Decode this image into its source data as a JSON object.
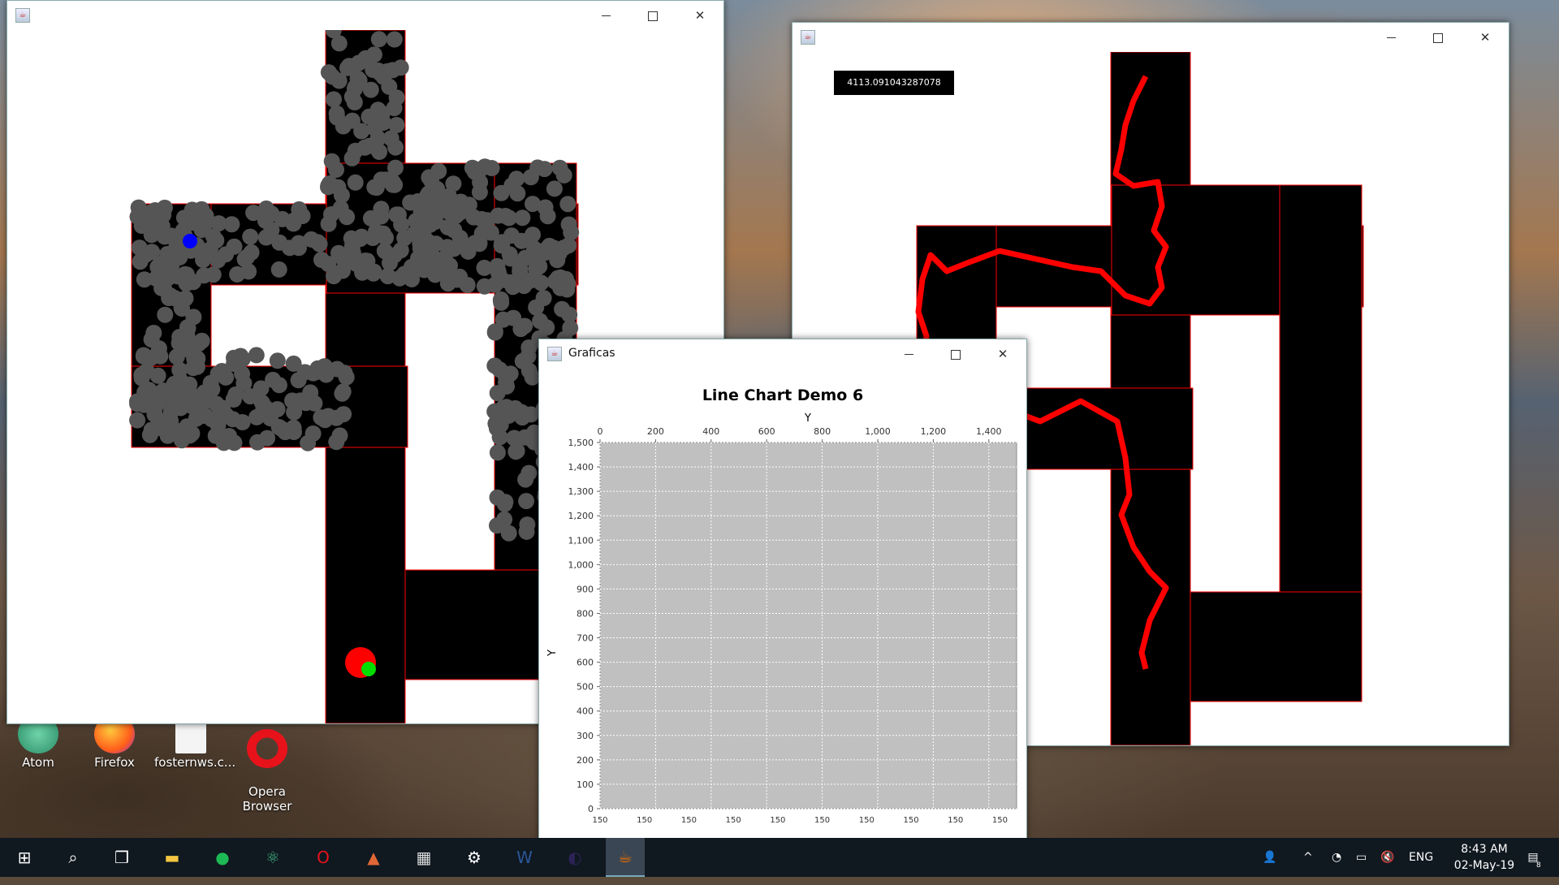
{
  "desktop_icons": [
    {
      "label": "Atom",
      "icon": "atom-icon",
      "color": "#41b883"
    },
    {
      "label": "Firefox",
      "icon": "firefox-icon",
      "color": "#ff7139"
    },
    {
      "label": "fosternws.c...",
      "icon": "file-icon",
      "color": "#f4f4f4"
    },
    {
      "label": "Opera\nBrowser",
      "icon": "opera-icon",
      "color": "#e8121b"
    }
  ],
  "window_map": {
    "title": "",
    "maze_color": "#000000",
    "visited_color": "#555555",
    "start_marker_color": "#0000ff",
    "goal_marker_color": "#ff0000",
    "agent_color": "#00dd00"
  },
  "window_path": {
    "title": "",
    "score_label": "4113.091043287078",
    "path_color": "#ff0000"
  },
  "window_chart": {
    "title": "Graficas",
    "chart_title": "Line Chart Demo 6",
    "top_axis_label": "Y",
    "left_axis_label": "Y",
    "plot_background": "#c0c0c0"
  },
  "chart_data": {
    "type": "line",
    "title": "Line Chart Demo 6",
    "xlabel": "Y",
    "ylabel": "Y",
    "xlim": [
      0,
      1500
    ],
    "ylim": [
      0,
      1500
    ],
    "x_ticks": [
      "0",
      "200",
      "400",
      "600",
      "800",
      "1,000",
      "1,200",
      "1,400"
    ],
    "x_tick_values": [
      0,
      200,
      400,
      600,
      800,
      1000,
      1200,
      1400
    ],
    "y_ticks": [
      "0",
      "100",
      "200",
      "300",
      "400",
      "500",
      "600",
      "700",
      "800",
      "900",
      "1,000",
      "1,100",
      "1,200",
      "1,300",
      "1,400",
      "1,500"
    ],
    "y_tick_values": [
      0,
      100,
      200,
      300,
      400,
      500,
      600,
      700,
      800,
      900,
      1000,
      1100,
      1200,
      1300,
      1400,
      1500
    ],
    "bottom_ticks": [
      "150",
      "150",
      "150",
      "150",
      "150",
      "150",
      "150",
      "150",
      "150",
      "150"
    ],
    "grid": true,
    "series": []
  },
  "taskbar": {
    "apps": [
      {
        "name": "start",
        "icon": "windows-icon",
        "color": "#ffffff"
      },
      {
        "name": "search",
        "icon": "search-icon",
        "color": "#ffffff"
      },
      {
        "name": "task-view",
        "icon": "task-view-icon",
        "color": "#ffffff"
      },
      {
        "name": "file-explorer",
        "icon": "folder-icon",
        "color": "#f4c542"
      },
      {
        "name": "spotify",
        "icon": "spotify-icon",
        "color": "#1db954"
      },
      {
        "name": "atom",
        "icon": "atom-icon",
        "color": "#41b883"
      },
      {
        "name": "opera",
        "icon": "opera-icon",
        "color": "#e8121b"
      },
      {
        "name": "matlab",
        "icon": "matlab-icon",
        "color": "#e16737"
      },
      {
        "name": "calculator",
        "icon": "calculator-icon",
        "color": "#dddddd"
      },
      {
        "name": "settings",
        "icon": "gear-icon",
        "color": "#ffffff"
      },
      {
        "name": "word",
        "icon": "word-icon",
        "color": "#2b579a"
      },
      {
        "name": "eclipse",
        "icon": "eclipse-icon",
        "color": "#2c2255"
      },
      {
        "name": "java",
        "icon": "java-icon",
        "color": "#e76f00"
      }
    ],
    "language": "ENG",
    "time": "8:43 AM",
    "date": "02-May-19",
    "notification_count": "8"
  }
}
